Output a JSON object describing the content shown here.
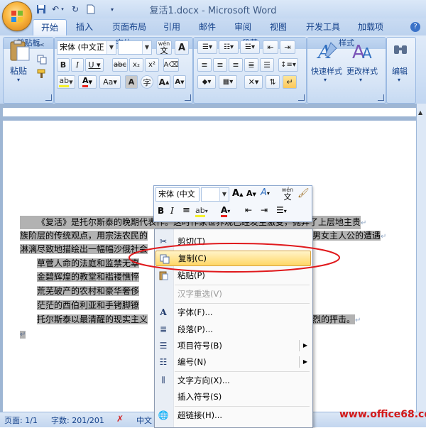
{
  "window": {
    "title": "复活1.docx - Microsoft Word"
  },
  "tabs": [
    "开始",
    "插入",
    "页面布局",
    "引用",
    "邮件",
    "审阅",
    "视图",
    "开发工具",
    "加载项"
  ],
  "clipboard": {
    "paste": "粘贴",
    "group": "剪贴板"
  },
  "font": {
    "name": "宋体 (中文正",
    "size": "",
    "group": "字体",
    "wen": "wén"
  },
  "paragraph": {
    "group": "段落"
  },
  "styles": {
    "quick": "快速样式",
    "change": "更改样式",
    "group": "样式"
  },
  "editing": {
    "label": "编辑"
  },
  "document": {
    "lines": [
      "《复活》是托尔斯泰的晚期代表作。这时作家世界观已经发生激变，抛弃了上层地主贵",
      "族阶层的传统观点，用宗法农民的",
      "淋漓尽致地描绘出一幅幅沙俄社会",
      "草菅人命的法庭和监禁无辜",
      "金碧辉煌的教堂和褴褛憔悴",
      "荒芜破产的农村和豪华奢侈",
      "茫茫的西伯利亚和手铐脚镣",
      "托尔斯泰以最清醒的现实主义"
    ],
    "right_fragments": [
      "男女主人公的遭遇",
      "烈的抨击。"
    ]
  },
  "mini_toolbar": {
    "font": "宋体 (中文",
    "size": ""
  },
  "context_menu": [
    {
      "label": "剪切(T)",
      "icon": "scissors-icon"
    },
    {
      "label": "复制(C)",
      "icon": "copy-icon",
      "highlight": true
    },
    {
      "label": "粘贴(P)",
      "icon": "paste-icon"
    },
    {
      "label": "汉字重选(V)",
      "disabled": true
    },
    {
      "label": "字体(F)...",
      "icon": "font-icon"
    },
    {
      "label": "段落(P)...",
      "icon": "paragraph-icon"
    },
    {
      "label": "项目符号(B)",
      "icon": "bullets-icon",
      "submenu": true
    },
    {
      "label": "编号(N)",
      "icon": "numbering-icon",
      "submenu": true
    },
    {
      "label": "文字方向(X)...",
      "icon": "text-direction-icon"
    },
    {
      "label": "插入符号(S)"
    },
    {
      "label": "超链接(H)...",
      "icon": "hyperlink-icon"
    }
  ],
  "status": {
    "page": "页面: 1/1",
    "words": "字数: 201/201",
    "lang": "中文"
  },
  "watermark": "www.office68.com",
  "colors": {
    "accent": "#15428b",
    "highlight": "#ffd766",
    "ellipse": "#e0191c"
  }
}
